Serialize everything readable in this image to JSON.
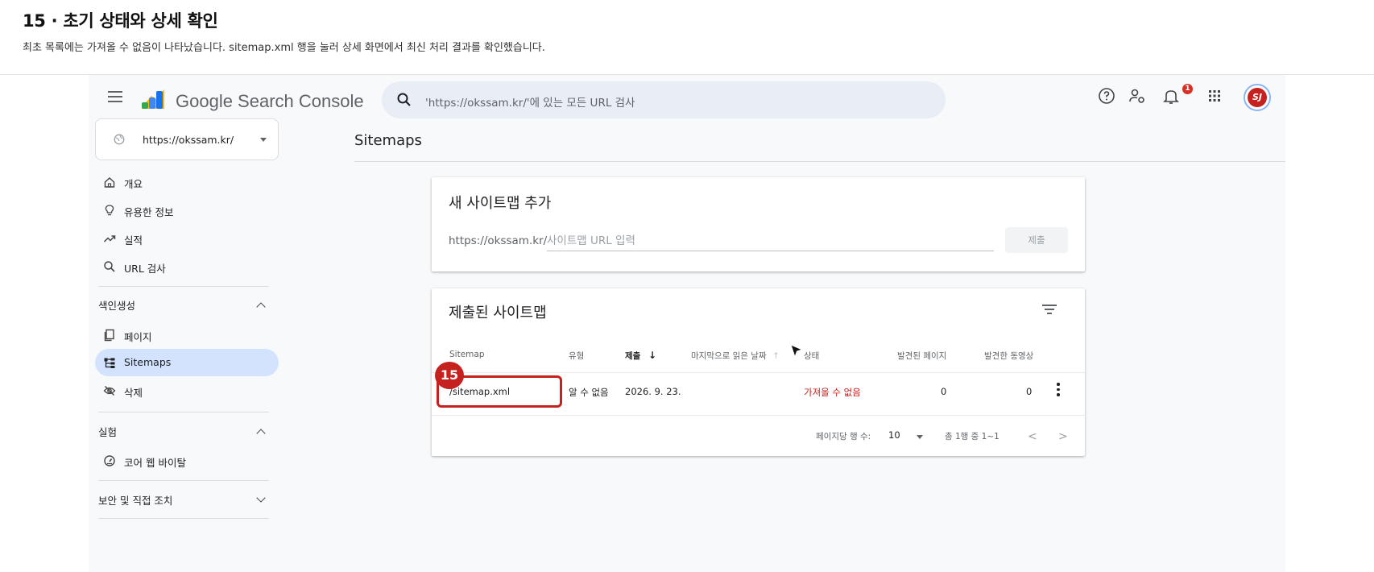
{
  "step": {
    "title": "15 · 초기 상태와 상세 확인",
    "description": "최초 목록에는 가져올 수 없음이 나타났습니다. sitemap.xml 행을 눌러 상세 화면에서 최신 처리 결과를 확인했습니다."
  },
  "app": {
    "name": "Google Search Console",
    "search_placeholder": "'https://okssam.kr/'에 있는 모든 URL 검사",
    "notification_count": "1",
    "avatar_initials": "SJ"
  },
  "property": {
    "url": "https://okssam.kr/"
  },
  "sidebar": {
    "top_items": [
      {
        "label": "개요",
        "icon": "home-icon"
      },
      {
        "label": "유용한 정보",
        "icon": "lightbulb-icon"
      },
      {
        "label": "실적",
        "icon": "trending-icon"
      },
      {
        "label": "URL 검사",
        "icon": "search-icon"
      }
    ],
    "indexing_header": "색인생성",
    "indexing_items": [
      {
        "label": "페이지",
        "icon": "pages-icon"
      },
      {
        "label": "Sitemaps",
        "icon": "sitemap-icon",
        "active": true
      },
      {
        "label": "삭제",
        "icon": "eye-off-icon"
      }
    ],
    "experience_header": "실험",
    "experience_items": [
      {
        "label": "코어 웹 바이탈",
        "icon": "gauge-icon"
      }
    ],
    "security_header": "보안 및 직접 조치"
  },
  "main": {
    "title": "Sitemaps",
    "add_card": {
      "title": "새 사이트맵 추가",
      "url_prefix": "https://okssam.kr/",
      "input_placeholder": "사이트맵 URL 입력",
      "submit_label": "제출"
    },
    "list_card": {
      "title": "제출된 사이트맵",
      "columns": {
        "sitemap": "Sitemap",
        "type": "유형",
        "submitted": "제출",
        "sort_arrow": "↓",
        "last_read": "마지막으로 읽은 날짜",
        "last_read_arrow": "↑",
        "status": "상태",
        "pages": "발견된 페이지",
        "videos": "발견한 동영상"
      },
      "rows": [
        {
          "sitemap": "/sitemap.xml",
          "type": "알 수 없음",
          "submitted": "2026. 9. 23.",
          "last_read": "",
          "status": "가져올 수 없음",
          "pages": "0",
          "videos": "0"
        }
      ],
      "pager": {
        "rows_per_page_label": "페이지당 행 수:",
        "rows_per_page": "10",
        "range": "총 1행 중 1~1",
        "prev": "<",
        "next": ">"
      }
    }
  },
  "callout": {
    "number": "15"
  },
  "colors": {
    "accent": "#c5221f",
    "active_nav": "#d3e3fd",
    "search_bg": "#e9eef6"
  }
}
